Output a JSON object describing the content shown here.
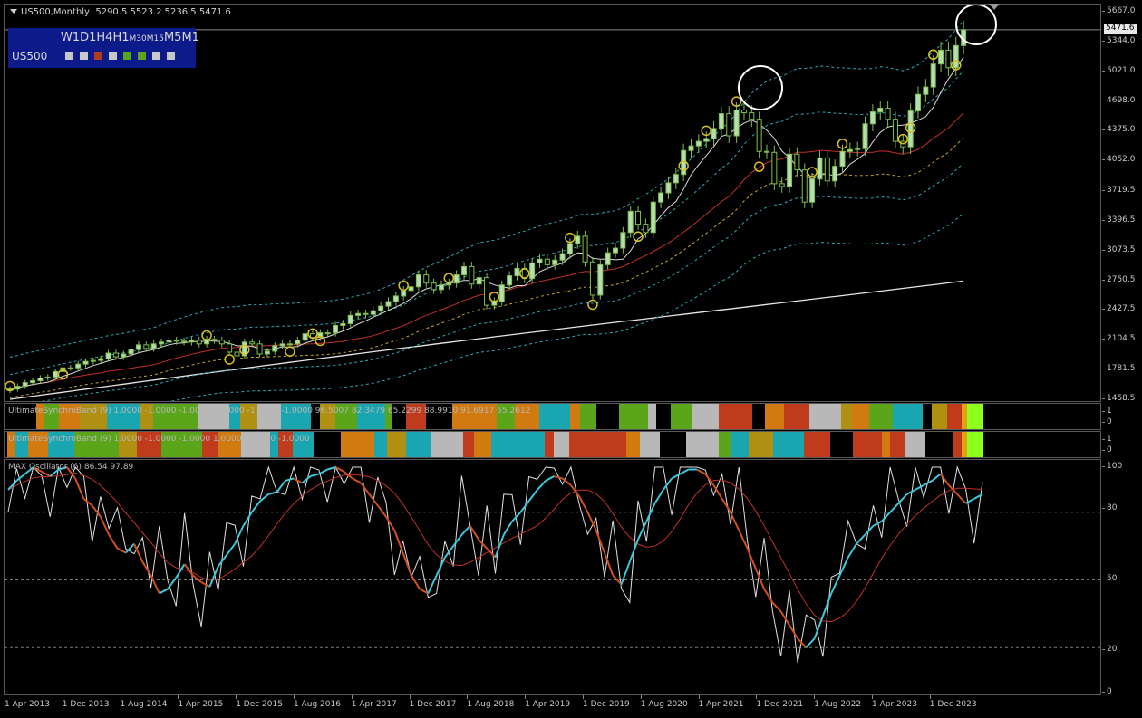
{
  "chart": {
    "symbol_timeframe": "US500,Monthly",
    "ohlc": "5290.5 5523.2 5236.5 5471.6",
    "current_price": "5471.6"
  },
  "timeframes": {
    "labels": [
      {
        "text": "W1",
        "small": false
      },
      {
        "text": "D1",
        "small": false
      },
      {
        "text": "H4",
        "small": false
      },
      {
        "text": "H1",
        "small": false
      },
      {
        "text": "M30",
        "small": true
      },
      {
        "text": "M15",
        "small": true
      },
      {
        "text": "M5",
        "small": false
      },
      {
        "text": "M1",
        "small": false
      }
    ],
    "symbol": "US500",
    "status_colors": [
      "#c8c8c8",
      "#c8c8c8",
      "#b33a1c",
      "#c8c8c8",
      "#5aa51a",
      "#5aa51a",
      "#c8c8c8",
      "#c8c8c8"
    ]
  },
  "price_axis": [
    "5667.0",
    "5344.0",
    "5021.0",
    "4698.0",
    "4375.0",
    "4052.0",
    "3719.5",
    "3396.5",
    "3073.5",
    "2750.5",
    "2427.5",
    "2104.5",
    "1781.5",
    "1458.5"
  ],
  "indicators": {
    "band1_label": "UltimateSynchroBand (9) 1.0000 -1.0000 -1.0000 -1.0000 -1.0000 -1.0000 96.5007 82.3479 65.2299 88.9910 91.6917 65.2612",
    "band2_label": "UltimateSynchroBand (9) 1.0000 -1.0000 -1.0000 1.0000 -1.0000 -1.0000",
    "band_axis": [
      "1",
      "0"
    ],
    "oscillator_label": "MAX Oscillator (6) 86.54 97.89",
    "oscillator_axis": [
      "100",
      "80",
      "50",
      "20",
      "0"
    ]
  },
  "time_axis": [
    "1 Apr 2013",
    "1 Dec 2013",
    "1 Aug 2014",
    "1 Apr 2015",
    "1 Dec 2015",
    "1 Aug 2016",
    "1 Apr 2017",
    "1 Dec 2017",
    "1 Aug 2018",
    "1 Apr 2019",
    "1 Dec 2019",
    "1 Aug 2020",
    "1 Apr 2021",
    "1 Dec 2021",
    "1 Aug 2022",
    "1 Apr 2023",
    "1 Dec 2023"
  ],
  "chart_data": {
    "type": "candlestick",
    "price_range": [
      1458.5,
      5667.0
    ],
    "oscillator_range": [
      0,
      100
    ],
    "close_series": [
      1570,
      1600,
      1640,
      1660,
      1690,
      1700,
      1760,
      1800,
      1800,
      1840,
      1870,
      1880,
      1900,
      1960,
      1920,
      1950,
      2000,
      2050,
      2010,
      2060,
      2080,
      2100,
      2090,
      2080,
      2100,
      2060,
      2110,
      2100,
      2060,
      1970,
      1930,
      2080,
      2060,
      1950,
      1980,
      2040,
      2060,
      2060,
      2100,
      2170,
      2130,
      2180,
      2180,
      2260,
      2280,
      2370,
      2390,
      2380,
      2420,
      2470,
      2520,
      2580,
      2640,
      2680,
      2810,
      2720,
      2650,
      2700,
      2720,
      2810,
      2900,
      2710,
      2780,
      2480,
      2520,
      2700,
      2800,
      2880,
      2770,
      2940,
      2980,
      2920,
      2970,
      3040,
      3150,
      3230,
      2950,
      2590,
      2920,
      3050,
      3100,
      3270,
      3500,
      3360,
      3270,
      3600,
      3700,
      3810,
      3900,
      4160,
      4210,
      4260,
      4290,
      4400,
      4560,
      4320,
      4600,
      4570,
      4500,
      4150,
      4140,
      3800,
      3770,
      4120,
      3950,
      3600,
      3850,
      4080,
      3830,
      3990,
      4150,
      4170,
      4180,
      4450,
      4580,
      4620,
      4500,
      4260,
      4200,
      4590,
      4770,
      4850,
      5100,
      5250,
      5060,
      5300,
      5471.6
    ],
    "oscillator_fast": [
      90,
      94,
      97,
      100,
      98,
      96,
      99,
      100,
      95,
      86,
      83,
      78,
      70,
      64,
      62,
      66,
      58,
      52,
      44,
      46,
      51,
      57,
      52,
      49,
      47,
      56,
      61,
      66,
      74,
      80,
      85,
      88,
      89,
      94,
      95,
      93,
      96,
      97,
      99,
      100,
      98,
      95,
      93,
      88,
      83,
      78,
      72,
      62,
      52,
      46,
      44,
      52,
      60,
      65,
      70,
      74,
      68,
      64,
      60,
      70,
      76,
      80,
      85,
      90,
      94,
      96,
      95,
      92,
      87,
      80,
      72,
      62,
      52,
      48,
      58,
      68,
      76,
      84,
      90,
      95,
      97,
      99,
      99,
      97,
      92,
      86,
      80,
      72,
      64,
      55,
      46,
      40,
      36,
      30,
      24,
      20,
      24,
      34,
      44,
      52,
      60,
      66,
      70,
      74,
      76,
      80,
      84,
      88,
      90,
      92,
      94,
      97,
      92,
      88,
      84,
      86,
      88
    ]
  }
}
